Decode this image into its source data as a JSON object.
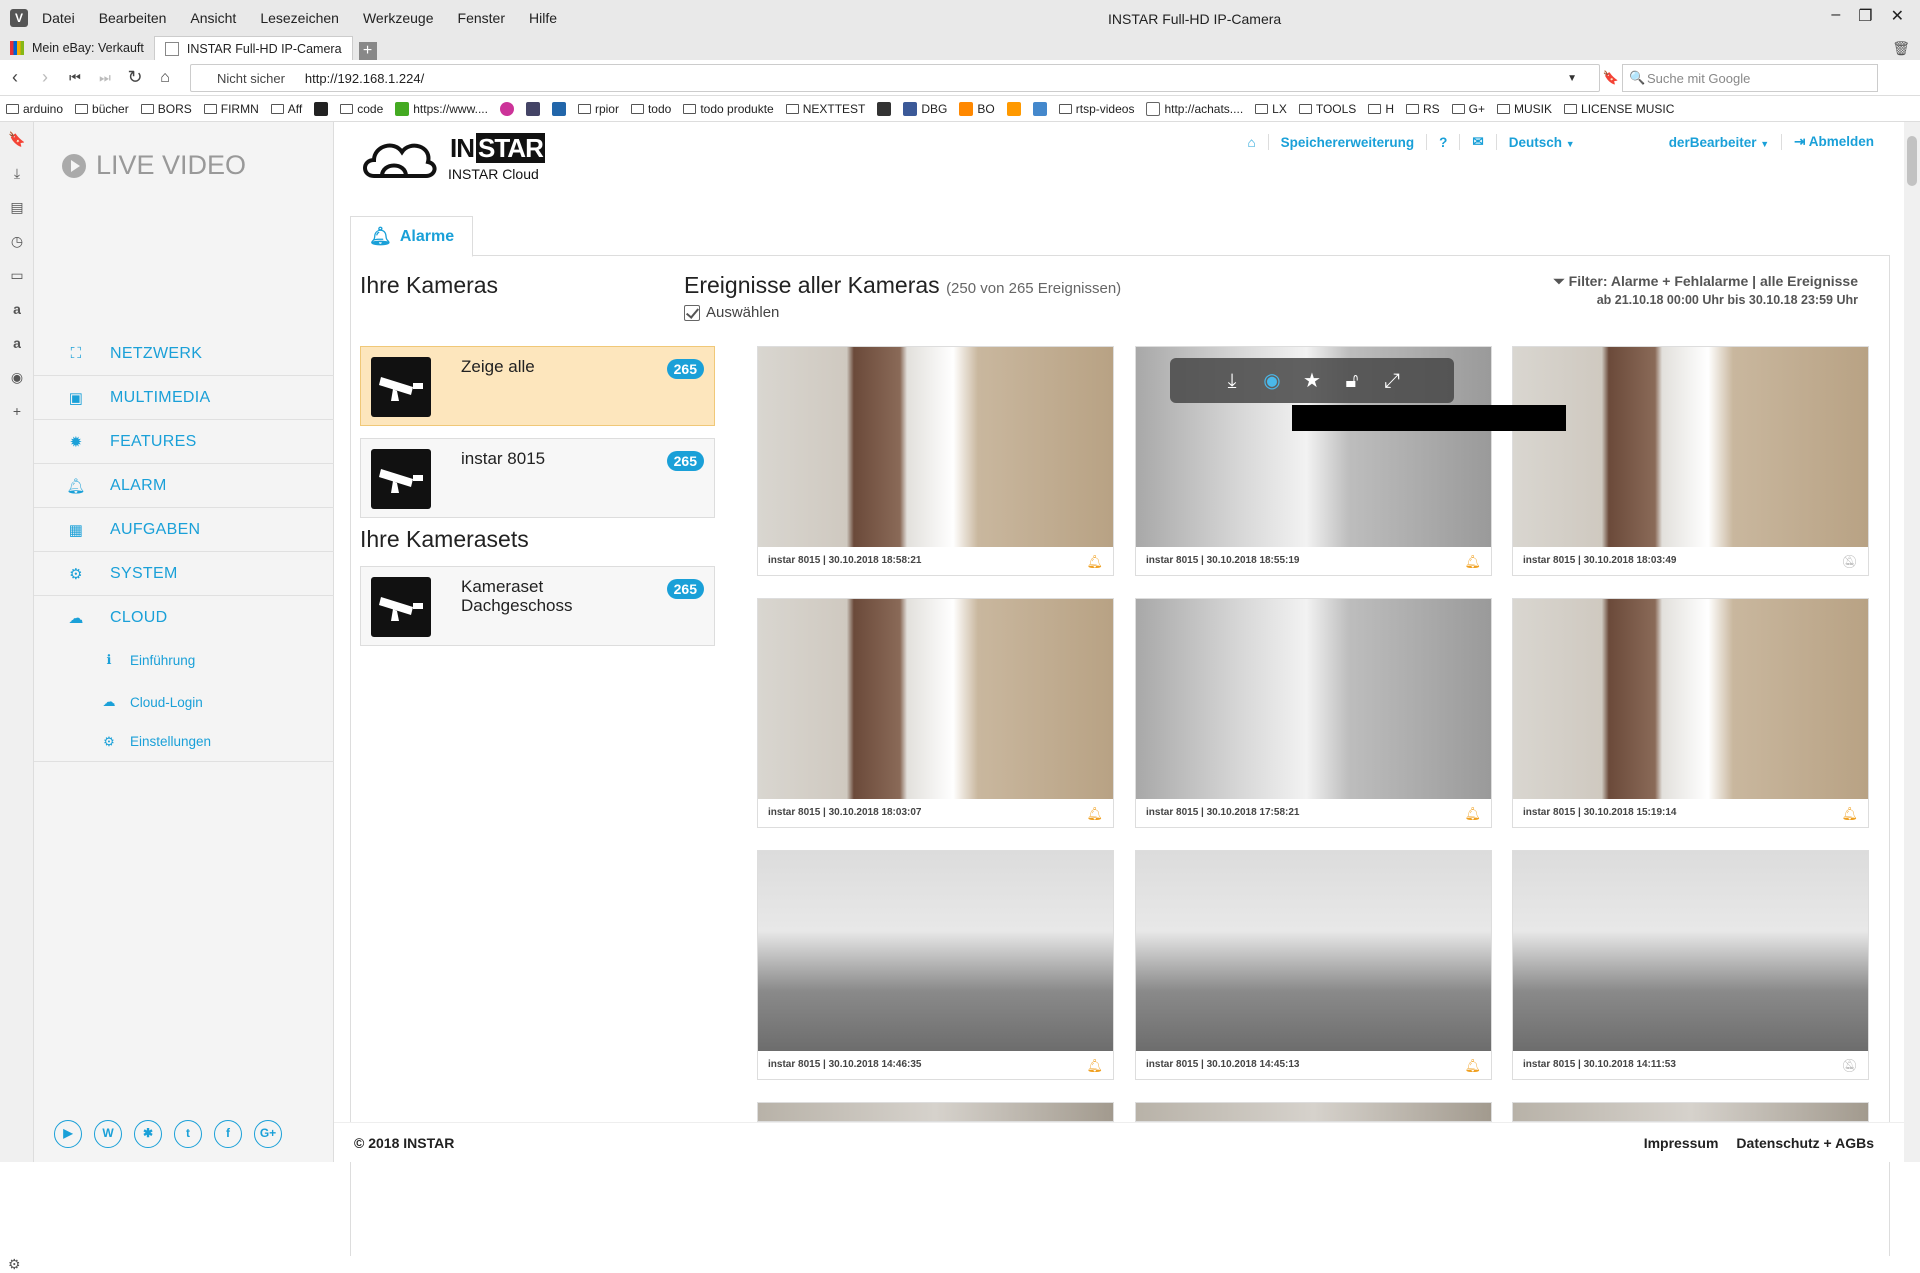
{
  "window": {
    "title": "INSTAR Full-HD IP-Camera",
    "menu": [
      "Datei",
      "Bearbeiten",
      "Ansicht",
      "Lesezeichen",
      "Werkzeuge",
      "Fenster",
      "Hilfe"
    ]
  },
  "tabs": [
    {
      "label": "Mein eBay: Verkauft"
    },
    {
      "label": "INSTAR Full-HD IP-Camera"
    }
  ],
  "address": {
    "security": "Nicht sicher",
    "url": "http://192.168.1.224/",
    "search_placeholder": "Suche mit Google"
  },
  "bookmarks": [
    "arduino",
    "bücher",
    "BORS",
    "FIRMN",
    "Aff",
    "code",
    "https://www....",
    "rpior",
    "todo",
    "todo produkte",
    "NEXTTEST",
    "DBG",
    "BO",
    "rtsp-videos",
    "http://achats....",
    "LX",
    "TOOLS",
    "H",
    "RS",
    "G+",
    "MUSIK",
    "LICENSE MUSIC"
  ],
  "sidebar": {
    "live": "LIVE VIDEO",
    "items": [
      {
        "label": "NETZWERK",
        "icon": "sitemap-icon"
      },
      {
        "label": "MULTIMEDIA",
        "icon": "image-icon"
      },
      {
        "label": "FEATURES",
        "icon": "cog-icon"
      },
      {
        "label": "ALARM",
        "icon": "bell-icon"
      },
      {
        "label": "AUFGABEN",
        "icon": "film-icon"
      },
      {
        "label": "SYSTEM",
        "icon": "gear-icon"
      },
      {
        "label": "CLOUD",
        "icon": "cloud-icon"
      }
    ],
    "subitems": [
      {
        "label": "Einführung",
        "icon": "info-icon"
      },
      {
        "label": "Cloud-Login",
        "icon": "cloud-icon"
      },
      {
        "label": "Einstellungen",
        "icon": "cogs-icon"
      }
    ]
  },
  "header": {
    "brand_text": "INSTAR",
    "cloud_label": "INSTAR Cloud",
    "nav": {
      "storage": "Speichererweiterung",
      "help": "?",
      "language": "Deutsch",
      "user": "derBearbeiter",
      "logout": "Abmelden"
    }
  },
  "alarm_tab": "Alarme",
  "cameras": {
    "title": "Ihre Kameras",
    "list": [
      {
        "name": "Zeige alle",
        "count": "265"
      },
      {
        "name": "instar 8015",
        "count": "265"
      }
    ],
    "sets_title": "Ihre Kamerasets",
    "sets": [
      {
        "name": "Kameraset Dachgeschoss",
        "count": "265"
      }
    ]
  },
  "events": {
    "title": "Ereignisse aller Kameras",
    "count_text": "(250 von 265 Ereignissen)",
    "select_label": "Auswählen",
    "filter_label": "Filter: Alarme + Fehlalarme | alle Ereignisse",
    "filter_range": "ab 21.10.18 00:00 Uhr bis 30.10.18 23:59 Uhr",
    "cards": [
      {
        "caption": "instar 8015 | 30.10.2018 18:58:21",
        "alarm": true
      },
      {
        "caption": "instar 8015 | 30.10.2018 18:55:19",
        "alarm": true
      },
      {
        "caption": "instar 8015 | 30.10.2018 18:03:49",
        "alarm": false
      },
      {
        "caption": "instar 8015 | 30.10.2018 18:03:07",
        "alarm": true
      },
      {
        "caption": "instar 8015 | 30.10.2018 17:58:21",
        "alarm": true
      },
      {
        "caption": "instar 8015 | 30.10.2018 15:19:14",
        "alarm": true
      },
      {
        "caption": "instar 8015 | 30.10.2018 14:46:35",
        "alarm": true
      },
      {
        "caption": "instar 8015 | 30.10.2018 14:45:13",
        "alarm": true
      },
      {
        "caption": "instar 8015 | 30.10.2018 14:11:53",
        "alarm": false
      }
    ]
  },
  "footer": {
    "copyright": "© 2018 INSTAR",
    "impressum": "Impressum",
    "privacy": "Datenschutz + AGBs"
  },
  "colors": {
    "accent": "#1aa0d8",
    "selected_bg": "#fde6bd",
    "alarm_bell": "#f0a020"
  }
}
